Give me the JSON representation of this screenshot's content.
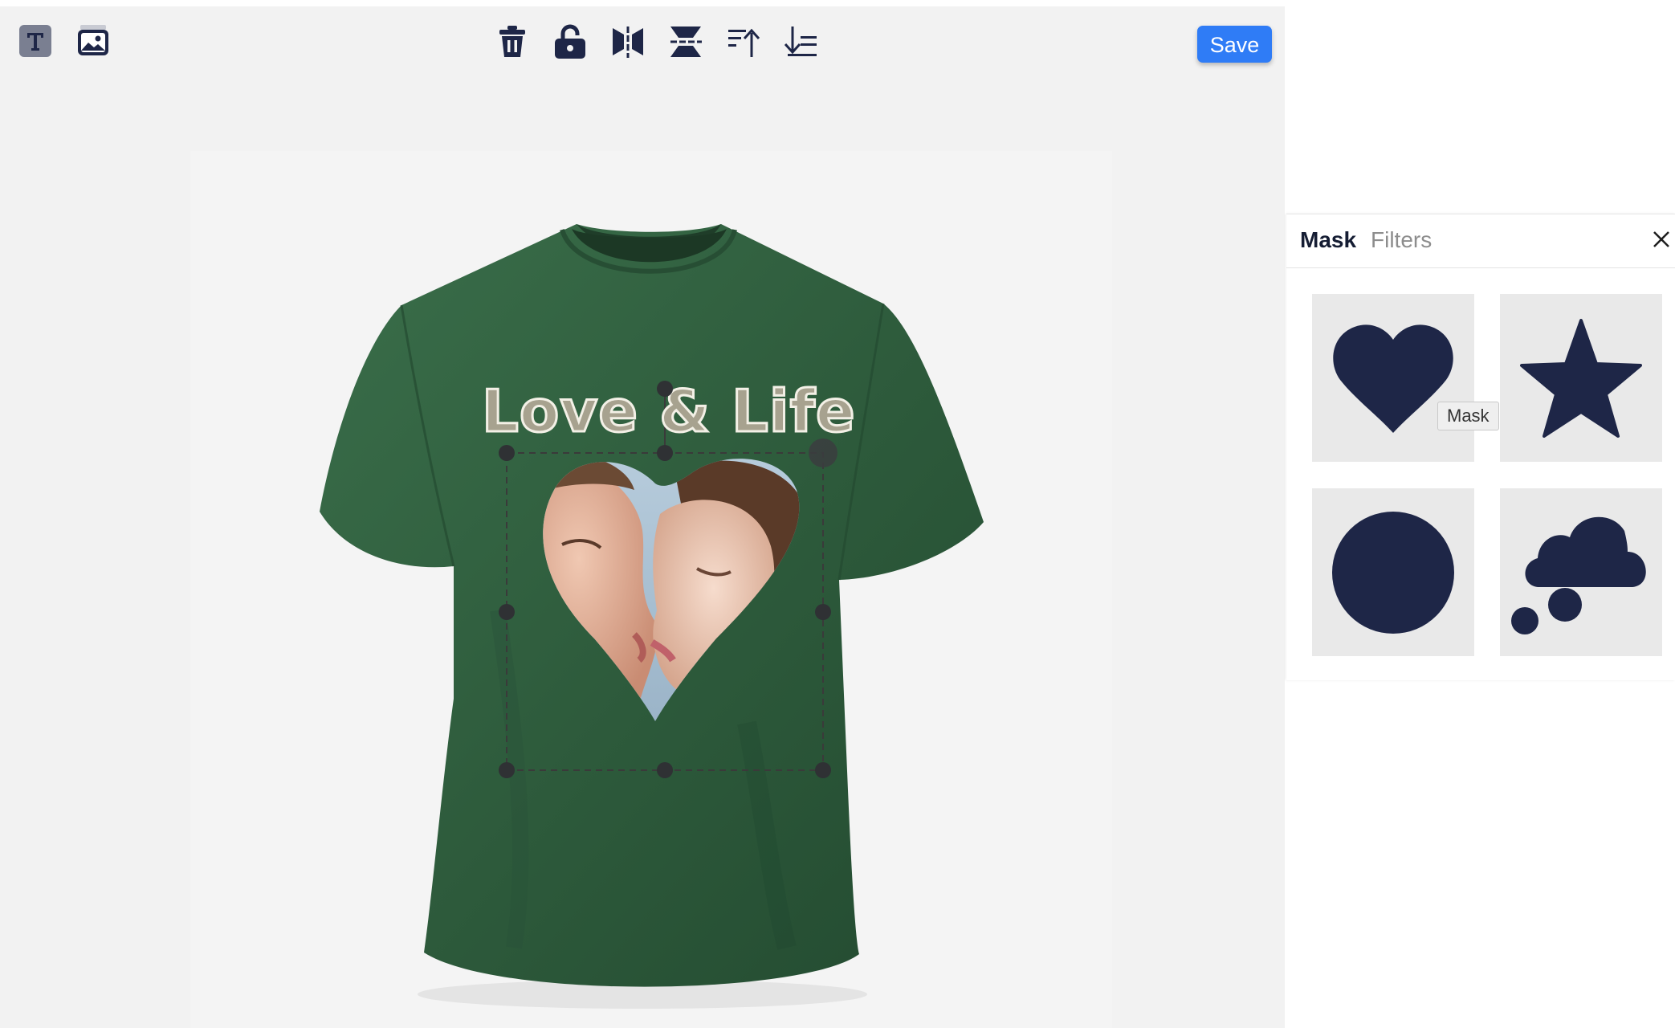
{
  "toolbar": {
    "left_tools": [
      {
        "icon": "text-tool-icon"
      },
      {
        "icon": "image-tool-icon"
      }
    ],
    "center_tools": [
      {
        "icon": "trash-icon"
      },
      {
        "icon": "unlock-icon"
      },
      {
        "icon": "flip-horizontal-icon"
      },
      {
        "icon": "flip-vertical-icon"
      },
      {
        "icon": "bring-forward-icon"
      },
      {
        "icon": "send-backward-icon"
      }
    ],
    "save_label": "Save"
  },
  "canvas": {
    "product": "t-shirt",
    "shirt_color": "#2e5a3b",
    "design_text": "Love & Life",
    "photo_mask": "heart"
  },
  "panel": {
    "tabs": [
      {
        "label": "Mask",
        "active": true
      },
      {
        "label": "Filters",
        "active": false
      }
    ],
    "masks": [
      {
        "shape": "heart",
        "icon": "heart-icon"
      },
      {
        "shape": "star",
        "icon": "star-icon"
      },
      {
        "shape": "circle",
        "icon": "circle-icon"
      },
      {
        "shape": "cloud",
        "icon": "thought-cloud-icon"
      }
    ],
    "mask_color": "#1e2647",
    "tooltip": "Mask"
  },
  "colors": {
    "accent": "#2f7cf6",
    "icon_dark": "#1e2647",
    "background": "#f2f2f2"
  }
}
